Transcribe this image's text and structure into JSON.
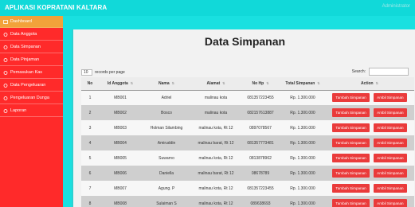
{
  "app": {
    "title": "APLIKASI KOPRATANI KALTARA",
    "user_label": "Administrator"
  },
  "sidebar": {
    "items": [
      {
        "label": "Dashboard",
        "icon": "window-icon"
      },
      {
        "label": "Data Anggota",
        "icon": "user-icon"
      },
      {
        "label": "Data Simpanan",
        "icon": "user-icon"
      },
      {
        "label": "Data Pinjaman",
        "icon": "user-icon"
      },
      {
        "label": "Pemasukan Kas",
        "icon": "user-icon"
      },
      {
        "label": "Data Pengeluaran",
        "icon": "user-icon"
      },
      {
        "label": "Pengeluaran Dunga",
        "icon": "user-icon"
      },
      {
        "label": "Laporan",
        "icon": "user-icon"
      }
    ],
    "colors": {
      "background": "#ff2a2a",
      "active": "#f2a23a"
    }
  },
  "main": {
    "title": "Data Simpanan",
    "show": {
      "value": "10",
      "suffix": "records per page"
    },
    "search_label": "Search:",
    "columns": [
      "No",
      "Id Anggota",
      "Nama",
      "Alamat",
      "No Hp",
      "Total Simpanan",
      "Action"
    ],
    "rows": [
      {
        "no": "1",
        "id": "MB001",
        "nama": "Adriel",
        "alamat": "malinau kota",
        "hp": "081357223455",
        "total": "Rp. 1.300.000"
      },
      {
        "no": "2",
        "id": "MB002",
        "nama": "Bosco",
        "alamat": "malinau kota",
        "hp": "082157613887",
        "total": "Rp. 1.300.000"
      },
      {
        "no": "3",
        "id": "MB003",
        "nama": "Holman Silambing",
        "alamat": "malinau kota, Rt 12",
        "hp": "0897078567",
        "total": "Rp. 1.300.000"
      },
      {
        "no": "4",
        "id": "MB004",
        "nama": "Amiruddin",
        "alamat": "malinau barat, Rt 12",
        "hp": "081357773481",
        "total": "Rp. 1.300.000"
      },
      {
        "no": "5",
        "id": "MB005",
        "nama": "Suwarno",
        "alamat": "malinau kota, Rt 12",
        "hp": "0813878962",
        "total": "Rp. 1.300.000"
      },
      {
        "no": "6",
        "id": "MB006",
        "nama": "Daniella",
        "alamat": "malinau barat, Rt 12",
        "hp": "08678789",
        "total": "Rp. 1.300.000"
      },
      {
        "no": "7",
        "id": "MB007",
        "nama": "Agung. P",
        "alamat": "malinau kota, Rt 12",
        "hp": "081357223455",
        "total": "Rp. 1.300.000"
      },
      {
        "no": "8",
        "id": "MB008",
        "nama": "Sulaiman S",
        "alamat": "malinau kota, Rt 12",
        "hp": "089638693",
        "total": "Rp. 1.300.000"
      }
    ],
    "actions": {
      "tambah": "Tambah Simpanan",
      "ambil": "Ambil Simpanan"
    }
  },
  "colors": {
    "topbar": "#11d9d9",
    "content_bg": "#19e0e0",
    "button": "#ea3b3b"
  }
}
